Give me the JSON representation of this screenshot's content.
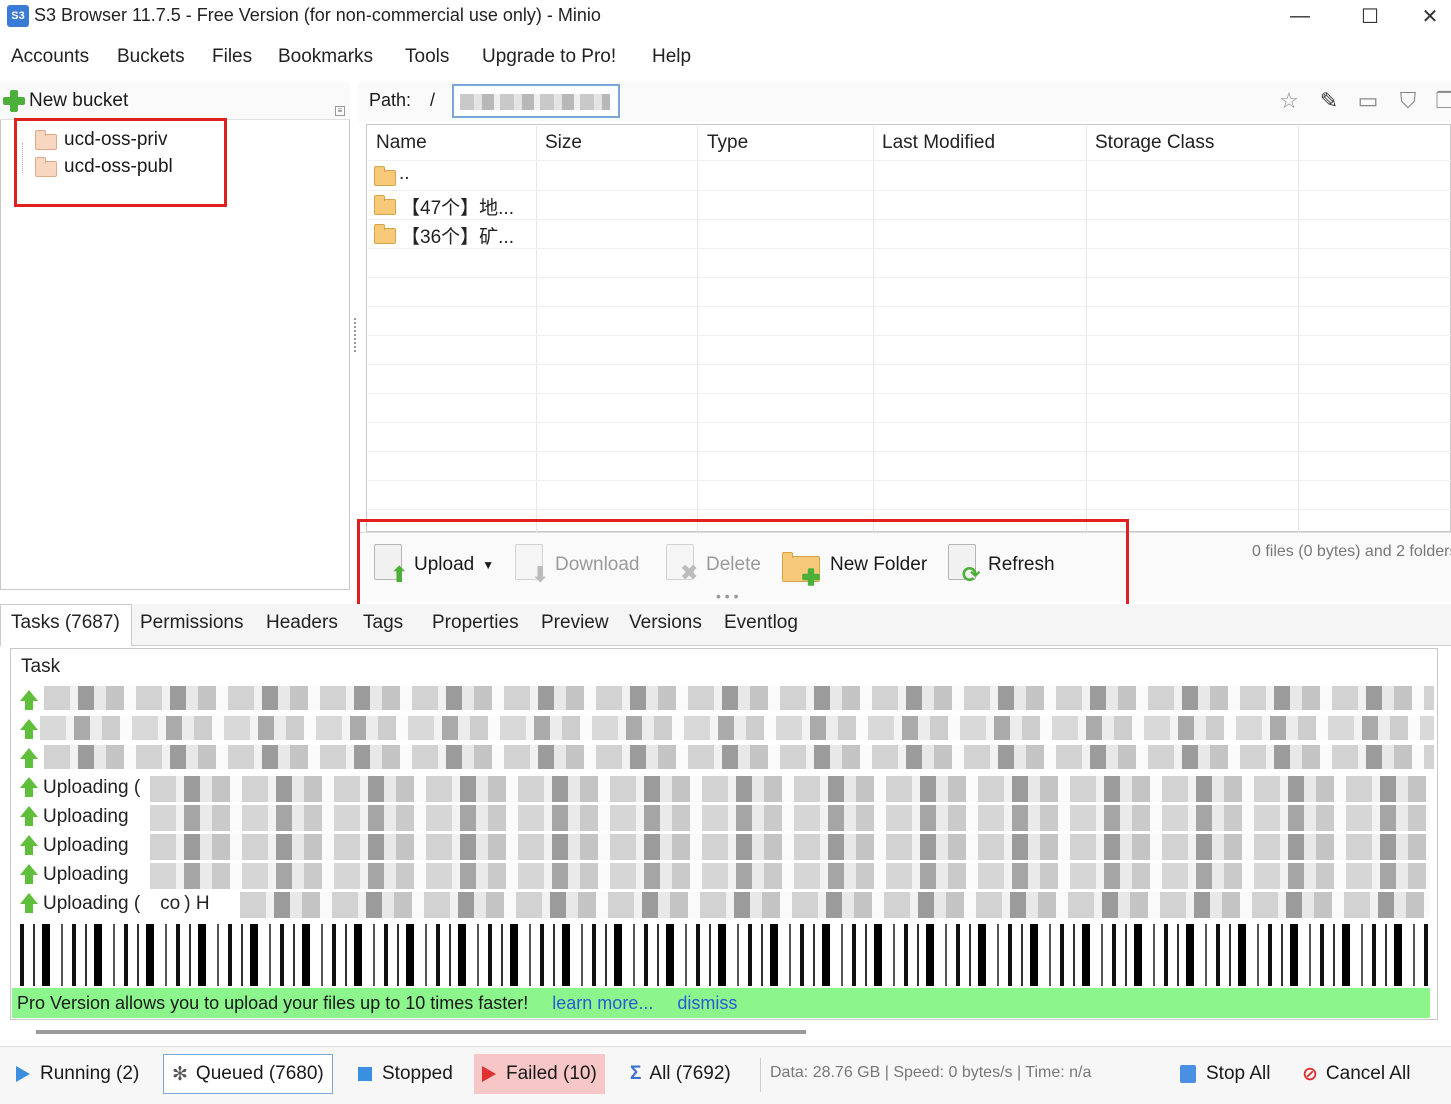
{
  "window": {
    "app_icon_text": "S3",
    "title": "S3 Browser 11.7.5 - Free Version (for non-commercial use only) - Minio",
    "minimize": "—",
    "maximize": "☐",
    "close": "✕"
  },
  "menu": [
    "Accounts",
    "Buckets",
    "Files",
    "Bookmarks",
    "Tools",
    "Upgrade to Pro!",
    "Help"
  ],
  "left_panel": {
    "new_bucket_label": "New bucket",
    "buckets": [
      "ucd-oss-priv",
      "ucd-oss-publ"
    ]
  },
  "path_bar": {
    "label": "Path:",
    "root": "/",
    "icons": [
      "star-icon",
      "pencil-icon",
      "window-icon",
      "filter-icon",
      "copy-icon"
    ]
  },
  "file_table": {
    "columns": [
      "Name",
      "Size",
      "Type",
      "Last Modified",
      "Storage Class"
    ],
    "rows": [
      {
        "name": ".."
      },
      {
        "name": "【47个】地..."
      },
      {
        "name": "【36个】矿..."
      }
    ]
  },
  "actions": {
    "upload": "Upload",
    "download": "Download",
    "delete": "Delete",
    "new_folder": "New Folder",
    "refresh": "Refresh",
    "status": "0 files (0 bytes) and 2 folders"
  },
  "tabs": [
    "Tasks (7687)",
    "Permissions",
    "Headers",
    "Tags",
    "Properties",
    "Preview",
    "Versions",
    "Eventlog"
  ],
  "tasks": {
    "column": "Task",
    "rows": [
      "Uploading (",
      "Uploading",
      "Uploading",
      "Uploading",
      "Uploading (",
      "co",
      ") H"
    ]
  },
  "banner": {
    "text": "Pro Version allows you to upload your files up to 10 times faster!",
    "learn_more": "learn more...",
    "dismiss": "dismiss"
  },
  "status_bar": {
    "running": "Running (2)",
    "queued": "Queued (7680)",
    "stopped": "Stopped",
    "failed": "Failed (10)",
    "all": "All (7692)",
    "data_info": "Data: 28.76 GB | Speed: 0 bytes/s | Time: n/a",
    "stop_all": "Stop All",
    "cancel_all": "Cancel All"
  },
  "colors": {
    "highlight_red": "#e02020",
    "banner_green": "#8cf58c",
    "link_blue": "#2a5ad8",
    "failed_bg": "#f7c6c6"
  }
}
